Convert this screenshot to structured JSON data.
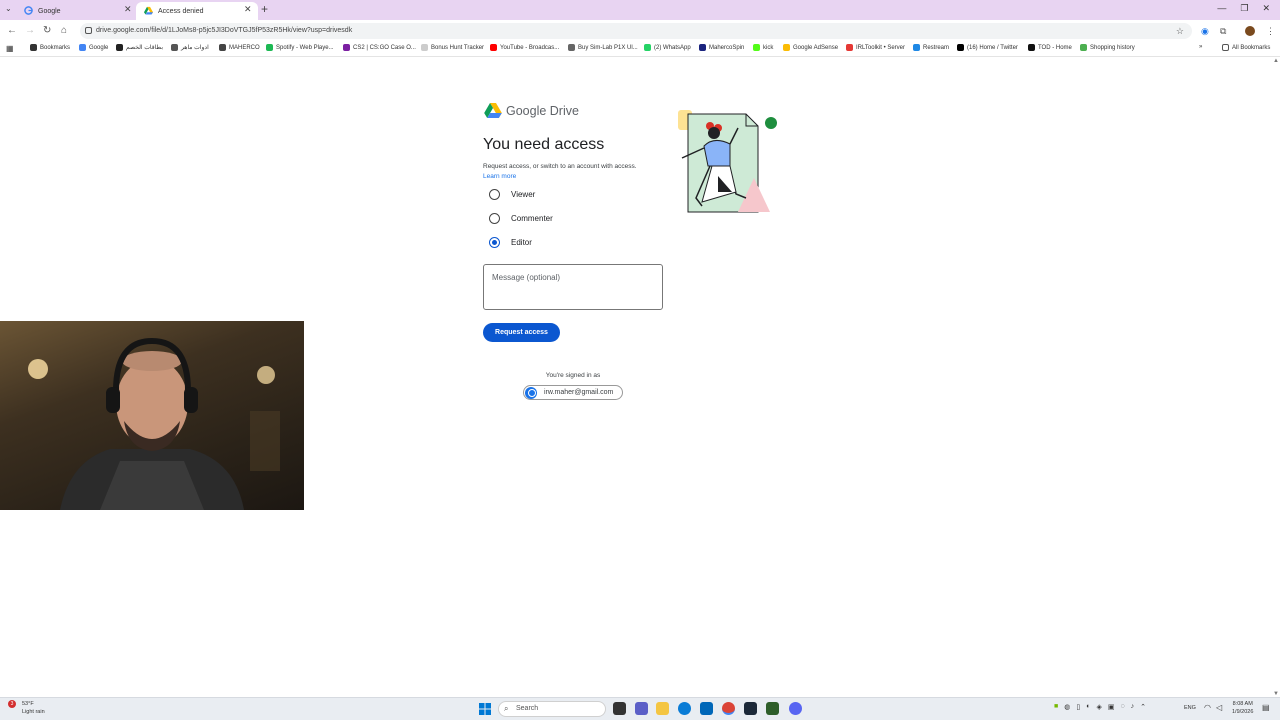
{
  "tabs": [
    {
      "title": "Google",
      "favicon": "google-icon"
    },
    {
      "title": "Access denied",
      "favicon": "drive-icon",
      "active": true
    }
  ],
  "toolbar": {
    "url": "drive.google.com/file/d/1LJoMs8-p5jc5JI3DoVTGJ5fP53zR5Hk/view?usp=drivesdk"
  },
  "bookmarks": [
    {
      "label": "Bookmarks",
      "icon": "star-icon",
      "color": "#333333"
    },
    {
      "label": "Google",
      "icon": "google-icon",
      "color": "#4285f4"
    },
    {
      "label": "بطاقات الخصم",
      "icon": "bookmark-icon",
      "color": "#222222"
    },
    {
      "label": "ادوات ماهر",
      "icon": "bookmark-icon",
      "color": "#555555"
    },
    {
      "label": "MAHERCO",
      "icon": "bookmark-icon",
      "color": "#444444"
    },
    {
      "label": "Spotify - Web Playe...",
      "icon": "spotify-icon",
      "color": "#1db954"
    },
    {
      "label": "CS2 | CS:GO Case O...",
      "icon": "bookmark-icon",
      "color": "#7b1fa2"
    },
    {
      "label": "Bonus Hunt Tracker",
      "icon": "bookmark-icon",
      "color": "#cccccc"
    },
    {
      "label": "YouTube - Broadcas...",
      "icon": "youtube-icon",
      "color": "#ff0000"
    },
    {
      "label": "Buy Sim-Lab P1X Ul...",
      "icon": "bookmark-icon",
      "color": "#666666"
    },
    {
      "label": "(2) WhatsApp",
      "icon": "whatsapp-icon",
      "color": "#25d366"
    },
    {
      "label": "MahercoSpin",
      "icon": "bookmark-icon",
      "color": "#1a237e"
    },
    {
      "label": "kick",
      "icon": "kick-icon",
      "color": "#53fc18"
    },
    {
      "label": "Google AdSense",
      "icon": "adsense-icon",
      "color": "#fbbc04"
    },
    {
      "label": "IRLToolkit • Server",
      "icon": "bookmark-icon",
      "color": "#e53935"
    },
    {
      "label": "Restream",
      "icon": "restream-icon",
      "color": "#1e88e5"
    },
    {
      "label": "(16) Home / Twitter",
      "icon": "x-icon",
      "color": "#000000"
    },
    {
      "label": "TOD - Home",
      "icon": "bookmark-icon",
      "color": "#111111"
    },
    {
      "label": "Shopping history",
      "icon": "bookmark-icon",
      "color": "#4caf50"
    }
  ],
  "all_bookmarks_label": "All Bookmarks",
  "drive": {
    "logo_text": "Google Drive",
    "heading": "You need access",
    "subtext": "Request access, or switch to an account with access.",
    "learn_more": "Learn more",
    "roles": [
      {
        "label": "Viewer",
        "selected": false
      },
      {
        "label": "Commenter",
        "selected": false
      },
      {
        "label": "Editor",
        "selected": true
      }
    ],
    "message_placeholder": "Message (optional)",
    "request_button": "Request access",
    "signed_in_label": "You're signed in as",
    "account_email": "irw.maher@gmail.com"
  },
  "taskbar": {
    "weather_temp": "53°F",
    "weather_desc": "Light rain",
    "weather_badge": "3",
    "search_placeholder": "Search",
    "language": "ENG",
    "time": "8:08 AM",
    "date": "1/9/2026"
  }
}
